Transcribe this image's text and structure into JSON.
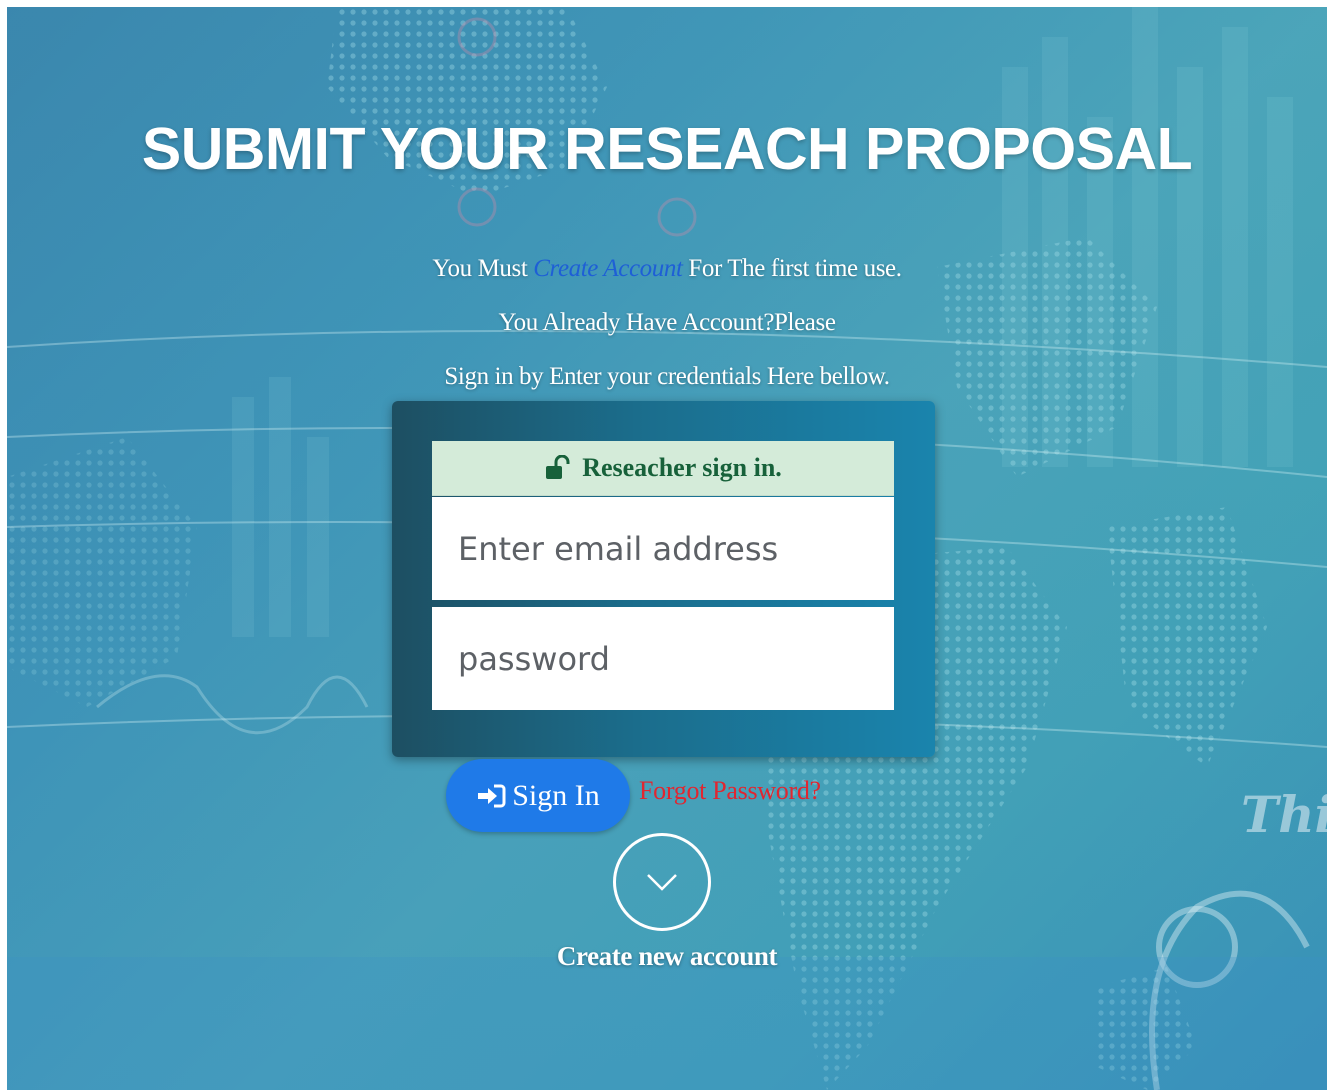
{
  "page": {
    "title": "SUBMIT YOUR RESEACH PROPOSAL",
    "intro": {
      "line1_prefix": "You Must ",
      "line1_link": "Create Account",
      "line1_suffix": " For The first time use.",
      "line2": "You Already Have Account?Please",
      "line3": "Sign in by Enter your credentials Here bellow."
    },
    "background_text": "Thi"
  },
  "login": {
    "header_icon": "unlock-icon",
    "header_label": "Reseacher sign in.",
    "email_placeholder": "Enter email address",
    "email_value": "",
    "password_placeholder": "password",
    "password_value": ""
  },
  "actions": {
    "signin_icon": "sign-in-icon",
    "signin_label": "Sign In",
    "forgot_label": "Forgot Password?",
    "create_icon": "chevron-down-icon",
    "create_label": "Create new account"
  },
  "colors": {
    "link": "#1e5fd6",
    "header_text": "#17613a",
    "header_bg": "#d4ebd9",
    "signin_button": "#1f7ae8",
    "forgot_link": "#e12630",
    "panel": "#1b6d8c"
  }
}
